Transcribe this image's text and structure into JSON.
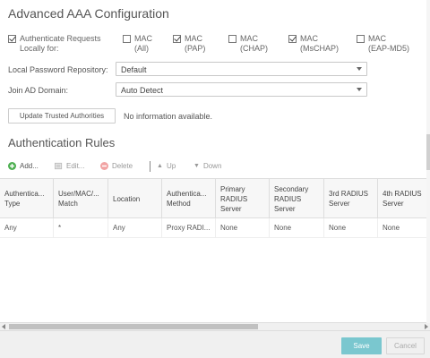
{
  "aaa": {
    "title": "Advanced AAA Configuration",
    "authenticate_label": "Authenticate Requests Locally for:",
    "options": [
      {
        "label": "MAC (All)",
        "checked": false
      },
      {
        "label": "MAC (PAP)",
        "checked": true
      },
      {
        "label": "MAC (CHAP)",
        "checked": false
      },
      {
        "label": "MAC (MsCHAP)",
        "checked": true
      },
      {
        "label": "MAC (EAP-MD5)",
        "checked": false
      }
    ],
    "password_repo_label": "Local Password Repository:",
    "password_repo_value": "Default",
    "join_ad_label": "Join AD Domain:",
    "join_ad_value": "Auto Detect",
    "update_button": "Update Trusted Authorities",
    "info_text": "No information available."
  },
  "rules": {
    "title": "Authentication Rules",
    "toolbar": {
      "add": "Add...",
      "edit": "Edit...",
      "delete": "Delete",
      "up": "Up",
      "down": "Down"
    },
    "columns": [
      "Authentica... Type",
      "User/MAC/... Match",
      "Location",
      "Authentica... Method",
      "Primary RADIUS Server",
      "Secondary RADIUS Server",
      "3rd RADIUS Server",
      "4th RADIUS Server"
    ],
    "rows": [
      [
        "Any",
        "*",
        "Any",
        "Proxy RADI...",
        "None",
        "None",
        "None",
        "None"
      ]
    ]
  },
  "footer": {
    "save": "Save",
    "cancel": "Cancel"
  },
  "colors": {
    "save_bg": "#7ac7cf",
    "add_icon": "#4caf50",
    "delete_icon": "#e57373"
  }
}
